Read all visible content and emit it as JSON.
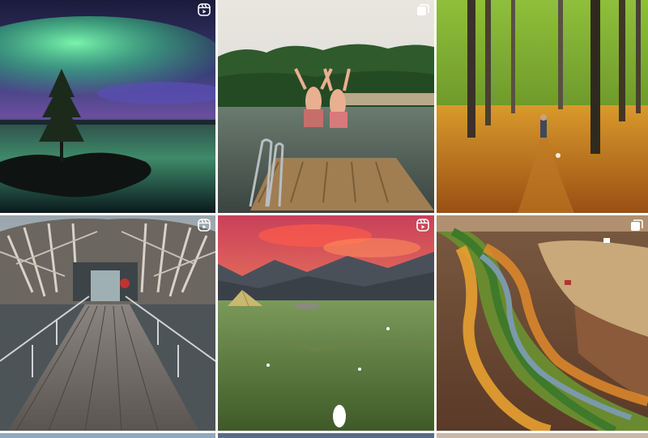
{
  "feed": {
    "posts": [
      {
        "subject": "aurora-over-lake",
        "type": "reel",
        "badge_icon": "reels-icon"
      },
      {
        "subject": "jumping-into-lake",
        "type": "carousel",
        "badge_icon": "carousel-icon"
      },
      {
        "subject": "autumn-beech-forest",
        "type": "photo",
        "badge_icon": ""
      },
      {
        "subject": "arctic-bath-boardwalk",
        "type": "reel",
        "badge_icon": "reels-icon"
      },
      {
        "subject": "mountain-camping-sunset",
        "type": "reel",
        "badge_icon": "reels-icon"
      },
      {
        "subject": "river-through-autumn-fields",
        "type": "carousel",
        "badge_icon": "carousel-icon"
      },
      {
        "subject": "next-row-1",
        "type": "photo",
        "badge_icon": ""
      },
      {
        "subject": "next-row-2",
        "type": "photo",
        "badge_icon": ""
      },
      {
        "subject": "next-row-3",
        "type": "photo",
        "badge_icon": ""
      }
    ]
  },
  "colors": {
    "background": "#ffffff",
    "aurora_green": "#4fd69a",
    "autumn_orange": "#c8741f",
    "sunset_pink": "#e86a5a"
  }
}
